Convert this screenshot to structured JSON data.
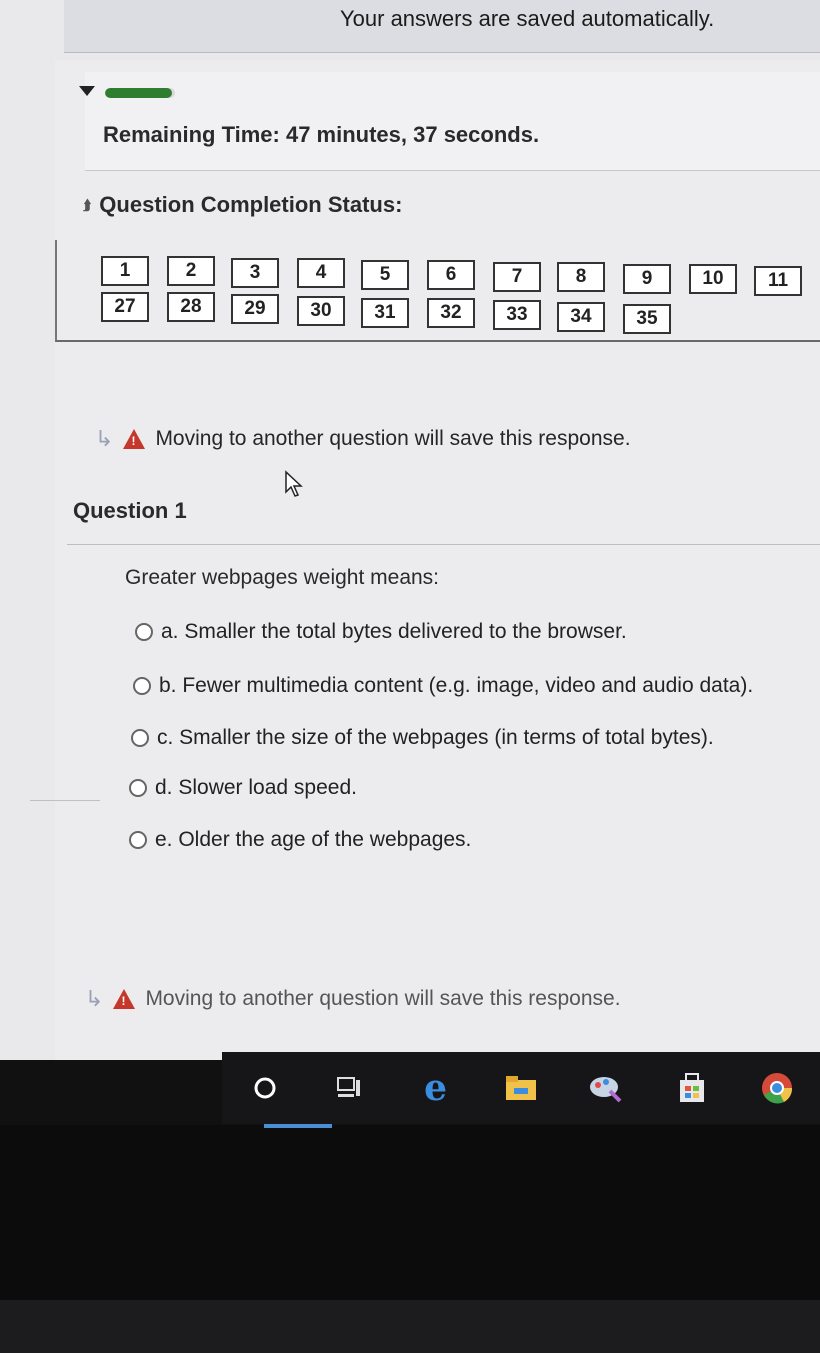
{
  "header": {
    "saved_message": "Your answers are saved automatically."
  },
  "timer": {
    "label": "Remaining Time: 47 minutes, 37 seconds.",
    "progress_fraction": 0.95
  },
  "completion": {
    "title": "Question Completion Status:",
    "row1": [
      "1",
      "2",
      "3",
      "4",
      "5",
      "6",
      "7",
      "8",
      "9",
      "10",
      "11"
    ],
    "row2": [
      "27",
      "28",
      "29",
      "30",
      "31",
      "32",
      "33",
      "34",
      "35"
    ]
  },
  "warning_text": "Moving to another question will save this response.",
  "question": {
    "title": "Question 1",
    "text": "Greater webpages weight means:",
    "options": [
      "a. Smaller the total bytes delivered to the browser.",
      "b. Fewer multimedia content (e.g. image, video and audio data).",
      "c. Smaller the size of the webpages (in terms of total bytes).",
      "d. Slower load speed.",
      "e. Older the age of the webpages."
    ]
  },
  "taskbar": {
    "icons": [
      "search-circle-icon",
      "task-view-icon",
      "edge-icon",
      "file-explorer-icon",
      "paint-icon",
      "store-icon",
      "chrome-icon"
    ],
    "accent": "#4a8fd6"
  }
}
